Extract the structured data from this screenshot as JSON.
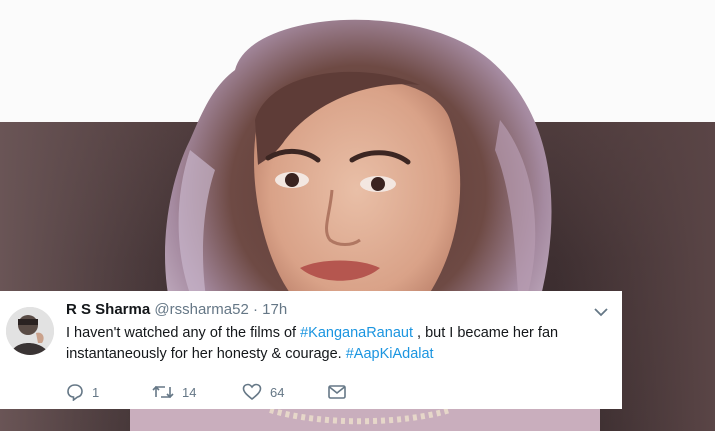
{
  "tweet": {
    "author_name": "R S Sharma",
    "handle": "@rssharma52",
    "separator": "·",
    "time": "17h",
    "text_part1": "I haven't watched any of the films of ",
    "hashtag1": "#KanganaRanaut",
    "text_part2": " , but I became her fan instantaneously for her honesty & courage. ",
    "hashtag2": "#AapKiAdalat",
    "actions": {
      "reply_count": "1",
      "retweet_count": "14",
      "like_count": "64"
    }
  },
  "icons": {
    "reply": "reply-icon",
    "retweet": "retweet-icon",
    "like": "heart-icon",
    "message": "envelope-icon",
    "menu": "chevron-down-icon"
  },
  "colors": {
    "hashtag": "#1b95e0",
    "secondary_text": "#657786",
    "primary_text": "#14171a",
    "card_background": "#ffffff"
  }
}
